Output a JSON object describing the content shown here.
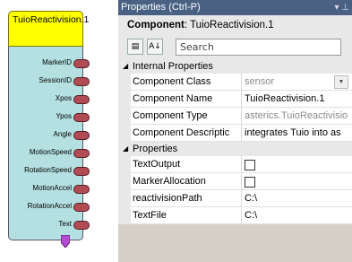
{
  "component_block": {
    "title": "TuioReactivision.1",
    "title_color": "#ffff00",
    "body_color": "#b4e0e2",
    "port_color": "#b14c55",
    "ports": [
      "MarkerID",
      "SessionID",
      "Xpos",
      "Ypos",
      "Angle",
      "MotionSpeed",
      "RotationSpeed",
      "MotionAccel",
      "RotationAccel",
      "Text"
    ]
  },
  "panel": {
    "title": "Properties (Ctrl-P)",
    "titlebar_icons": "▾ ⊥",
    "component_label": "Component",
    "component_value": ": TuioReactivision.1",
    "search_placeholder": "Search",
    "sort_icon_categorized": "categorized-icon",
    "sort_icon_alpha": "alphabetical-sort-icon"
  },
  "sections": [
    {
      "title": "Internal Properties",
      "rows": [
        {
          "name": "Component Class",
          "value": "sensor",
          "muted": true,
          "dropdown": true
        },
        {
          "name": "Component Name",
          "value": "TuioReactivision.1"
        },
        {
          "name": "Component Type",
          "value": "asterics.TuioReactivisio",
          "muted": true
        },
        {
          "name": "Component Descriptic",
          "value": "integrates Tuio into as"
        }
      ]
    },
    {
      "title": "Properties",
      "rows": [
        {
          "name": "TextOutput",
          "checkbox": true
        },
        {
          "name": "MarkerAllocation",
          "checkbox": true
        },
        {
          "name": "reactivisionPath",
          "value": "C:\\"
        },
        {
          "name": "TextFile",
          "value": "C:\\"
        }
      ]
    }
  ]
}
